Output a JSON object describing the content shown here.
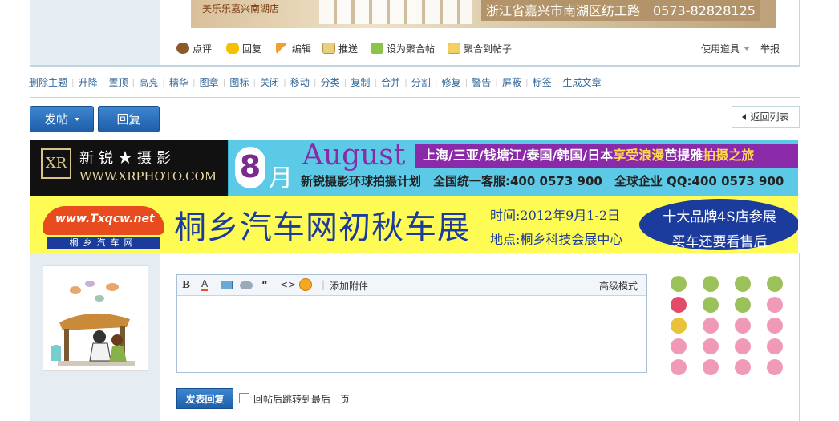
{
  "top_ad": {
    "store": "美乐乐嘉兴南湖店",
    "address": "浙江省嘉兴市南湖区纺工路　0573-82828125"
  },
  "actions": [
    {
      "label": "点评"
    },
    {
      "label": "回复"
    },
    {
      "label": "编辑"
    },
    {
      "label": "推送"
    },
    {
      "label": "设为聚合帖"
    },
    {
      "label": "聚合到帖子"
    }
  ],
  "actions_right": {
    "tools": "使用道具",
    "report": "举报"
  },
  "mod_links": [
    "删除主题",
    "升降",
    "置顶",
    "高亮",
    "精华",
    "图章",
    "图标",
    "关闭",
    "移动",
    "分类",
    "复制",
    "合并",
    "分割",
    "修复",
    "警告",
    "屏蔽",
    "标签",
    "生成文章"
  ],
  "buttons": {
    "post": "发帖",
    "reply": "回复",
    "back": "返回列表"
  },
  "banner1": {
    "logo_mark": "XR",
    "logo_cn": "新锐★摄影",
    "logo_url": "WWW.XRPHOTO.COM",
    "month_num": "8",
    "month_cn": "月",
    "month_en": "August",
    "destinations": "上海/三亚/钱塘江/泰国/韩国/日本",
    "highlight": "享受浪漫",
    "tail_a": "芭提雅",
    "tail_b": "拍摄之旅",
    "line2": "新锐摄影环球拍摄计划　全国统一客服:400 0573 900　全球企业 QQ:400 0573 900"
  },
  "banner2": {
    "brand": "www.Txqcw.net",
    "brand_cn": "桐乡汽车网",
    "title": "桐乡汽车网初秋车展",
    "time": "时间:2012年9月1-2日",
    "place": "地点:桐乡科技会展中心",
    "oval_line1": "十大品牌4S店参展",
    "oval_line2": "买车还要看售后"
  },
  "editor": {
    "attach": "添加附件",
    "advanced": "高级模式"
  },
  "reply_form": {
    "submit": "发表回复",
    "checkbox_label": "回帖后跳转到最后一页"
  },
  "colors": {
    "accent": "#1f5ea8",
    "link": "#336699",
    "border": "#c2d5e3",
    "side_bg": "#e5edf2"
  }
}
